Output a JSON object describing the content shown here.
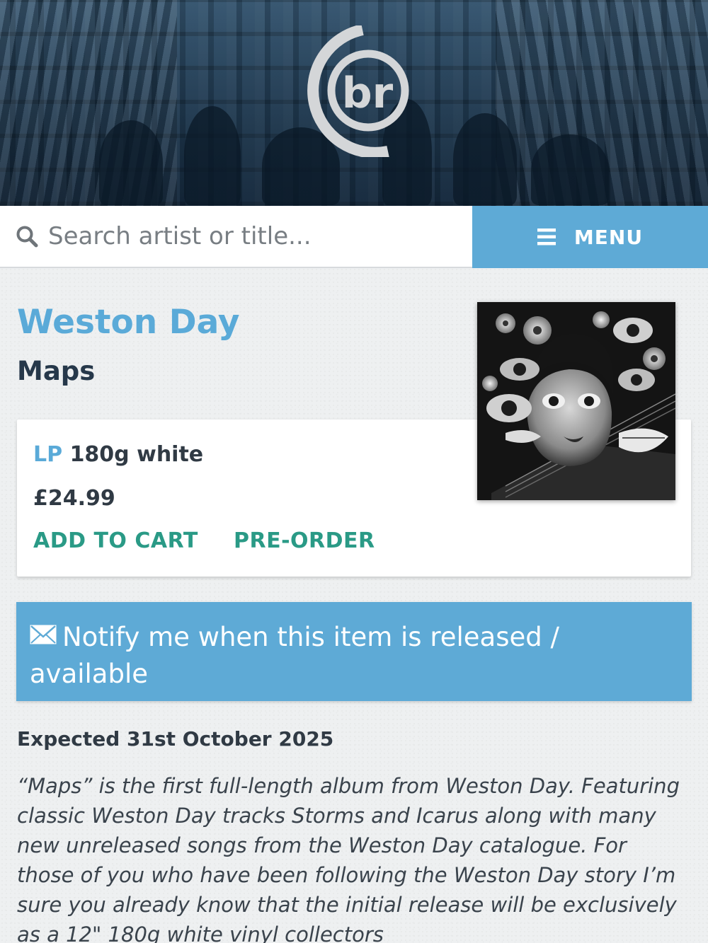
{
  "header": {
    "logo_text": "br"
  },
  "search": {
    "placeholder": "Search artist or title..."
  },
  "menu": {
    "label": "MENU"
  },
  "product": {
    "artist": "Weston Day",
    "title": "Maps",
    "format_type": "LP",
    "format_desc": "180g white",
    "price": "£24.99",
    "add_to_cart_label": "ADD TO CART",
    "pre_order_label": "PRE-ORDER"
  },
  "notify": {
    "label": "Notify me when this item is released / available"
  },
  "release": {
    "expected": "Expected 31st October 2025"
  },
  "description": "“Maps” is the first full-length album from Weston Day. Featuring classic Weston Day tracks Storms and Icarus along with many new unreleased songs from the Weston Day catalogue. For those of you who have been following the Weston Day story I’m sure you already know that the initial release will be exclusively as a 12\" 180g white vinyl collectors",
  "colors": {
    "accent_blue": "#5eaad6",
    "action_green": "#2a9a86",
    "title_dark": "#26384a"
  },
  "icons": {
    "search": "search-icon",
    "menu": "hamburger-icon",
    "notify": "envelope-icon"
  }
}
